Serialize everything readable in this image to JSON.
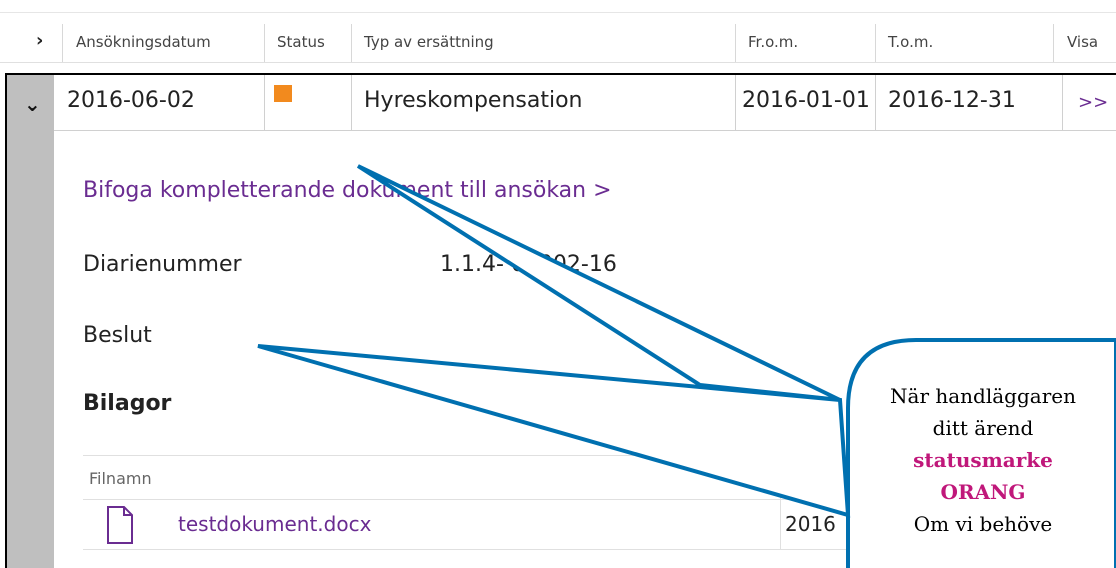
{
  "table_header": {
    "columns": [
      "Ansökningsdatum",
      "Status",
      "Typ av ersättning",
      "Fr.o.m.",
      "T.o.m.",
      "Visa"
    ]
  },
  "row": {
    "date": "2016-06-02",
    "status_color": "#f28a1e",
    "type": "Hyreskompensation",
    "from": "2016-01-01",
    "to": "2016-12-31",
    "visa_link": ">>"
  },
  "details": {
    "attach_link": "Bifoga kompletterande dokument till ansökan >",
    "diarienummer_label": "Diarienummer",
    "diarienummer_value": "1.1.4-  04002-16",
    "beslut_label": "Beslut",
    "bilagor_label": "Bilagor"
  },
  "attachments": {
    "header_filename": "Filnamn",
    "files": [
      {
        "name": "testdokument.docx",
        "date": "2016"
      }
    ]
  },
  "callout": {
    "line1": "När handläggaren",
    "line2": "ditt ärend",
    "line3": "statusmarke",
    "line4": "ORANG",
    "line5": "Om vi behöve",
    "accent_color": "#c0177a",
    "arrow_color": "#0070b0"
  }
}
